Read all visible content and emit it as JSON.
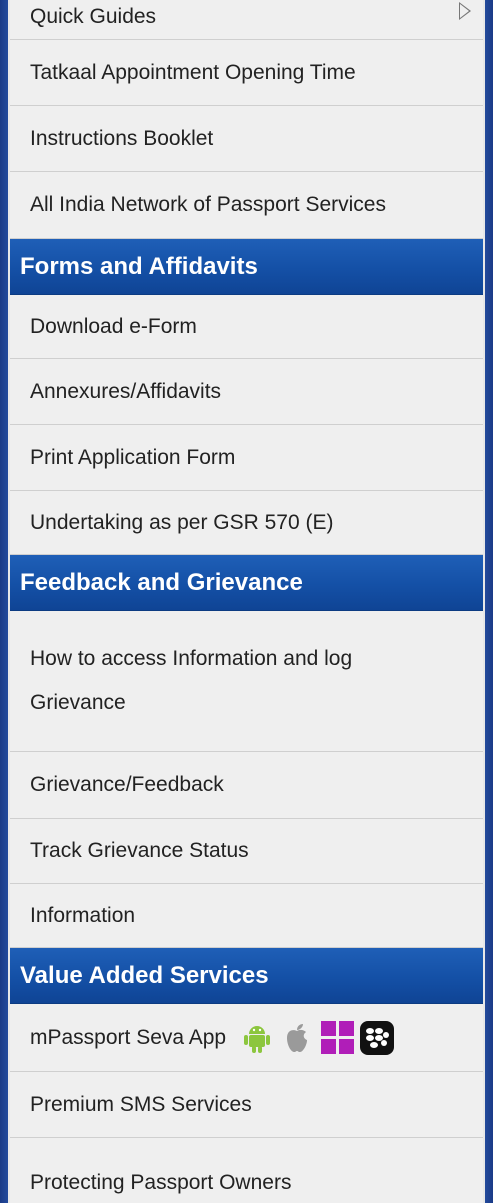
{
  "menu": {
    "top_items": [
      {
        "label": "Quick Guides"
      },
      {
        "label": "Tatkaal Appointment Opening Time"
      },
      {
        "label": "Instructions Booklet"
      },
      {
        "label": "All India Network of Passport Services"
      }
    ],
    "sections": [
      {
        "title": "Forms and Affidavits",
        "items": [
          {
            "label": "Download e-Form"
          },
          {
            "label": "Annexures/Affidavits"
          },
          {
            "label": "Print Application Form"
          },
          {
            "label": "Undertaking as per GSR 570 (E)"
          }
        ]
      },
      {
        "title": "Feedback and Grievance",
        "items": [
          {
            "label_line1": "How to access Information and log",
            "label_line2": "Grievance"
          },
          {
            "label": "Grievance/Feedback"
          },
          {
            "label": "Track Grievance Status"
          },
          {
            "label": "Information"
          }
        ]
      },
      {
        "title": "Value Added Services",
        "items": [
          {
            "label": "mPassport Seva App",
            "app_icons": [
              "android-icon",
              "apple-icon",
              "windows-icon",
              "blackberry-icon"
            ]
          },
          {
            "label": "Premium SMS Services"
          },
          {
            "label": "Protecting Passport Owners"
          }
        ]
      }
    ],
    "colors": {
      "section_header": "#1450a6",
      "border_frame": "#1e3f8a",
      "item_background": "#efefef",
      "android": "#8cc63e",
      "apple": "#9a9a9a",
      "windows": "#b01eb8",
      "blackberry": "#111111"
    }
  }
}
